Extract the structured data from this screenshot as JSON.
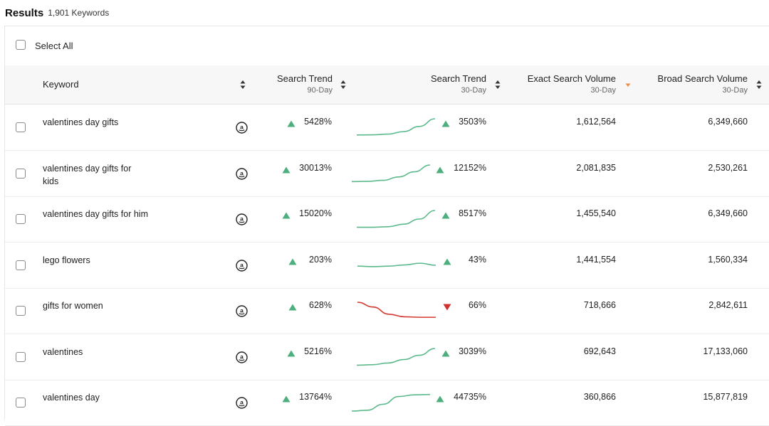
{
  "header": {
    "title": "Results",
    "count": "1,901 Keywords"
  },
  "select_all": {
    "label": "Select All"
  },
  "columns": {
    "keyword": "Keyword",
    "trend90": {
      "label": "Search Trend",
      "sub": "90-Day"
    },
    "trend30": {
      "label": "Search Trend",
      "sub": "30-Day"
    },
    "exact": {
      "label": "Exact Search Volume",
      "sub": "30-Day"
    },
    "broad": {
      "label": "Broad Search Volume",
      "sub": "30-Day"
    }
  },
  "colors": {
    "up": "#4caf7d",
    "down": "#d0302f",
    "sort_active": "#f08a3c",
    "spark_up": "#5bb98b",
    "spark_down": "#d23a2f"
  },
  "icons": {
    "amazon": "amazon-icon",
    "sort": "sort-icon",
    "up": "trend-up-icon",
    "down": "trend-down-icon"
  },
  "rows": [
    {
      "keyword": "valentines day gifts",
      "trend90": "5428%",
      "trend30": "3503%",
      "trend30_dir": "up",
      "exact": "1,612,564",
      "broad": "6,349,660",
      "spark": [
        0.05,
        0.06,
        0.1,
        0.25,
        0.55,
        1.0
      ]
    },
    {
      "keyword": "valentines day gifts for kids",
      "trend90": "30013%",
      "trend30": "12152%",
      "trend30_dir": "up",
      "exact": "2,081,835",
      "broad": "2,530,261",
      "spark": [
        0.03,
        0.04,
        0.1,
        0.3,
        0.6,
        1.0
      ]
    },
    {
      "keyword": "valentines day gifts for him",
      "trend90": "15020%",
      "trend30": "8517%",
      "trend30_dir": "up",
      "exact": "1,455,540",
      "broad": "6,349,660",
      "spark": [
        0.02,
        0.02,
        0.05,
        0.2,
        0.5,
        1.0
      ]
    },
    {
      "keyword": "lego flowers",
      "trend90": "203%",
      "trend30": "43%",
      "trend30_dir": "up",
      "exact": "1,441,554",
      "broad": "1,560,334",
      "spark": [
        0.45,
        0.42,
        0.45,
        0.52,
        0.62,
        0.5
      ]
    },
    {
      "keyword": "gifts for women",
      "trend90": "628%",
      "trend30": "66%",
      "trend30_dir": "down",
      "exact": "718,666",
      "broad": "2,842,611",
      "spark": [
        1.0,
        0.72,
        0.3,
        0.15,
        0.12,
        0.12
      ]
    },
    {
      "keyword": "valentines",
      "trend90": "5216%",
      "trend30": "3039%",
      "trend30_dir": "up",
      "exact": "692,643",
      "broad": "17,133,060",
      "spark": [
        0.02,
        0.05,
        0.15,
        0.35,
        0.6,
        1.0
      ]
    },
    {
      "keyword": "valentines day",
      "trend90": "13764%",
      "trend30": "44735%",
      "trend30_dir": "up",
      "exact": "360,866",
      "broad": "15,877,819",
      "spark": [
        0.0,
        0.05,
        0.4,
        0.85,
        0.95,
        0.97
      ]
    }
  ]
}
